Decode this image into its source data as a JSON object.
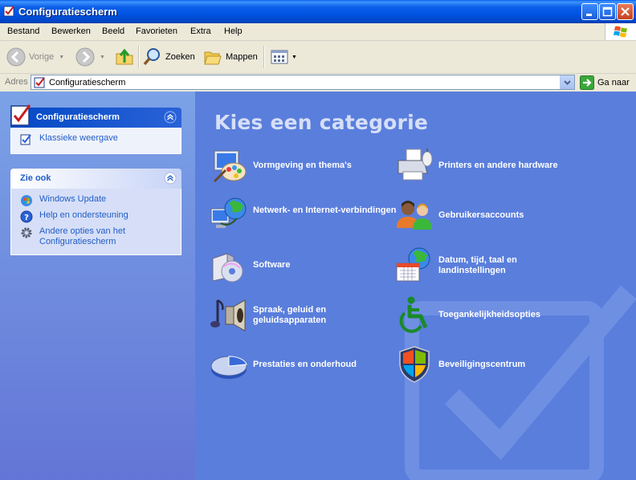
{
  "window": {
    "title": "Configuratiescherm"
  },
  "menu": {
    "items": [
      "Bestand",
      "Bewerken",
      "Beeld",
      "Favorieten",
      "Extra",
      "Help"
    ]
  },
  "toolbar": {
    "back_label": "Vorige",
    "search_label": "Zoeken",
    "folders_label": "Mappen"
  },
  "address": {
    "label": "Adres",
    "value": "Configuratiescherm",
    "go_label": "Ga naar"
  },
  "left_pane": {
    "control_panel": {
      "title": "Configuratiescherm",
      "links": [
        "Klassieke weergave"
      ]
    },
    "see_also": {
      "title": "Zie ook",
      "links": [
        "Windows Update",
        "Help en ondersteuning",
        "Andere opties van het Configuratiescherm"
      ]
    }
  },
  "main": {
    "heading": "Kies een categorie",
    "categories_left": [
      {
        "label": "Vormgeving en thema's",
        "icon": "appearance-themes-icon"
      },
      {
        "label": "Netwerk- en Internet-verbindingen",
        "icon": "network-connections-icon"
      },
      {
        "label": "Software",
        "icon": "add-remove-programs-icon"
      },
      {
        "label": "Spraak, geluid en geluidsapparaten",
        "icon": "sounds-audio-icon"
      },
      {
        "label": "Prestaties en onderhoud",
        "icon": "performance-maintenance-icon"
      }
    ],
    "categories_right": [
      {
        "label": "Printers en andere hardware",
        "icon": "printer-hardware-icon"
      },
      {
        "label": "Gebruikersaccounts",
        "icon": "user-accounts-icon"
      },
      {
        "label": "Datum, tijd, taal en landinstellingen",
        "icon": "date-time-language-icon"
      },
      {
        "label": "Toegankelijkheidsopties",
        "icon": "accessibility-icon"
      },
      {
        "label": "Beveiligingscentrum",
        "icon": "security-center-icon"
      }
    ]
  },
  "colors": {
    "titlebar": "#0054e3",
    "main_background": "#5a7edc",
    "link": "#215dc6"
  }
}
